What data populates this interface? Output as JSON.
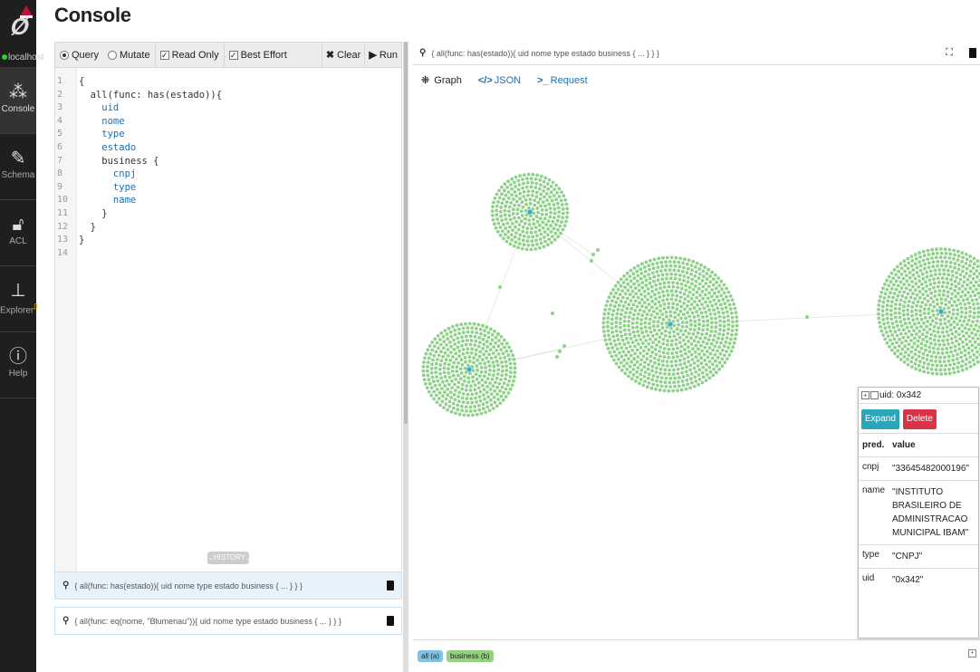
{
  "sidebar": {
    "host": "localhost",
    "items": [
      {
        "label": "Console",
        "icon": "console-icon"
      },
      {
        "label": "Schema",
        "icon": "schema-icon"
      },
      {
        "label": "ACL",
        "icon": "lock-icon"
      },
      {
        "label": "Explorer",
        "icon": "explorer-icon",
        "badge": "β"
      },
      {
        "label": "Help",
        "icon": "help-icon"
      }
    ]
  },
  "page": {
    "title": "Console"
  },
  "toolbar": {
    "query": "Query",
    "mutate": "Mutate",
    "read_only": "Read Only",
    "best_effort": "Best Effort",
    "clear": "Clear",
    "run": "Run"
  },
  "editor": {
    "lines": [
      {
        "n": "1",
        "text": "{"
      },
      {
        "n": "2",
        "text": "  all(func: has(estado)){"
      },
      {
        "n": "3",
        "text": "    uid"
      },
      {
        "n": "4",
        "text": "    nome"
      },
      {
        "n": "5",
        "text": "    type"
      },
      {
        "n": "6",
        "text": "    estado"
      },
      {
        "n": "7",
        "text": "    business {"
      },
      {
        "n": "8",
        "text": "      cnpj"
      },
      {
        "n": "9",
        "text": "      type"
      },
      {
        "n": "10",
        "text": "      name"
      },
      {
        "n": "11",
        "text": "    }"
      },
      {
        "n": "12",
        "text": "  }"
      },
      {
        "n": "13",
        "text": "}"
      },
      {
        "n": "14",
        "text": ""
      }
    ]
  },
  "history": {
    "button": "HISTORY",
    "items": [
      "{ all(func: has(estado)){ uid nome type estado business { ... } } }",
      "{ all(func: eq(nome, \"Blumenau\")){ uid nome type estado business { ... } } }"
    ]
  },
  "result": {
    "query": "{ all(func: has(estado)){ uid nome type estado business { ... } } }",
    "tabs": [
      {
        "icon": "graph-icon",
        "label": "Graph"
      },
      {
        "icon": "code-icon",
        "label": "JSON"
      },
      {
        "icon": "terminal-icon",
        "label": "Request"
      }
    ],
    "legend": [
      {
        "label": "all (a)",
        "color": "#7fc4e8"
      },
      {
        "label": "business (b)",
        "color": "#93d27f"
      }
    ]
  },
  "node_panel": {
    "title": "uid: 0x342",
    "expand": "Expand",
    "delete": "Delete",
    "headers": {
      "pred": "pred.",
      "value": "value"
    },
    "rows": [
      {
        "pred": "cnpj",
        "value": "\"33645482000196\""
      },
      {
        "pred": "name",
        "value": "\"INSTITUTO BRASILEIRO DE ADMINISTRACAO MUNICIPAL IBAM\""
      },
      {
        "pred": "type",
        "value": "\"CNPJ\""
      },
      {
        "pred": "uid",
        "value": "\"0x342\""
      }
    ]
  },
  "colors": {
    "sidebar_bg": "#1f1f1f",
    "node_green": "#8fd18a",
    "node_blue": "#3aa7d8",
    "expand_button": "#2aa6bb",
    "delete_button": "#d9334a"
  }
}
